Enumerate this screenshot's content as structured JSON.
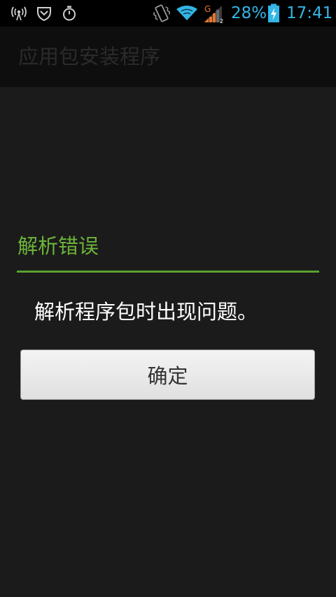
{
  "status_bar": {
    "battery_percent": "28%",
    "time": "17:41",
    "network_type": "G",
    "accent_color": "#33b5e5",
    "icons": [
      "wireless-hotspot-icon",
      "shield-icon",
      "stopwatch-icon",
      "vibrate-icon",
      "wifi-icon",
      "cellular-signal-icon",
      "battery-charging-icon"
    ]
  },
  "app_bar": {
    "title": "应用包安装程序"
  },
  "dialog": {
    "title": "解析错误",
    "message": "解析程序包时出现问题。",
    "ok_label": "确定",
    "accent_color": "#6cb33a"
  }
}
